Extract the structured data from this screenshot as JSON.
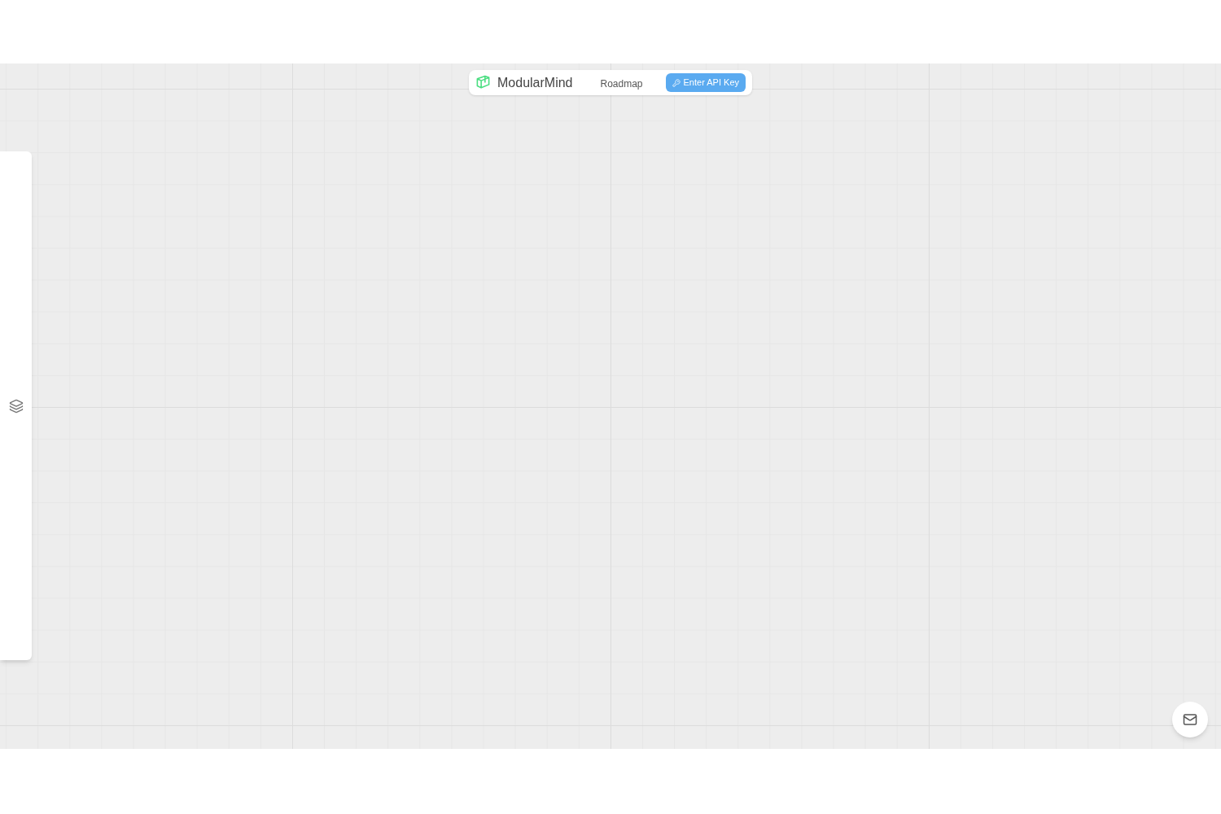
{
  "header": {
    "app_name": "ModularMind",
    "nav_link": "Roadmap",
    "api_button": "Enter API Key"
  }
}
